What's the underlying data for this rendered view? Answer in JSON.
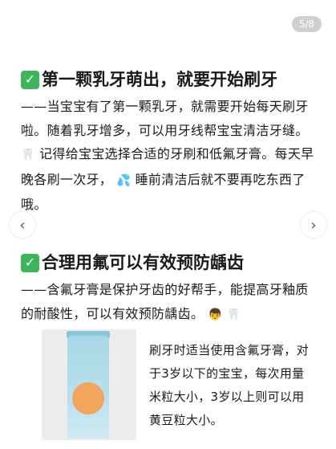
{
  "pager": {
    "indicator": "5/8"
  },
  "section1": {
    "title": "第一颗乳牙萌出，就要开始刷牙",
    "body_a": "——当宝宝有了第一颗乳牙，就需要开始每天刷牙啦。随着乳牙增多，可以用牙线帮宝宝清洁牙缝。",
    "body_b": "记得给宝宝选择合适的牙刷和低氟牙膏。每天早晚各刷一次牙，",
    "body_c": "睡前清洁后就不要再吃东西了哦。"
  },
  "section2": {
    "title": "合理用氟可以有效预防龋齿",
    "body": "——含氟牙膏是保护牙齿的好帮手，能提高牙釉质的耐酸性，可以有效预防龋齿。"
  },
  "side_note": "刷牙时适当使用含氟牙膏，对于3岁以下的宝宝，每次用量米粒大小，3岁以上则可以用黄豆粒大小。",
  "icons": {
    "check": "check-mark-icon",
    "tooth": "tooth-icon",
    "droplets": "droplets-icon",
    "child": "child-face-icon"
  },
  "colors": {
    "check_green": "#3db55a"
  }
}
